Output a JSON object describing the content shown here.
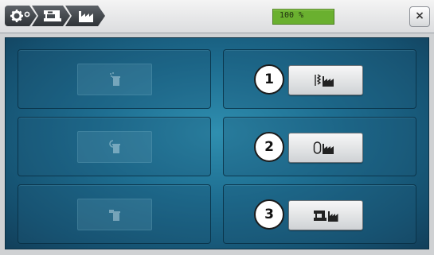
{
  "toolbar": {
    "breadcrumbs": [
      {
        "icon": "settings-icon"
      },
      {
        "icon": "machine-icon"
      },
      {
        "icon": "factory-icon"
      }
    ],
    "progress": {
      "value_text": "100 %",
      "value": 1.0,
      "color": "#6ab02f"
    },
    "close_label": "×"
  },
  "options": [
    {
      "number": "1",
      "icon": "stitch-factory-reset-icon"
    },
    {
      "number": "2",
      "icon": "hoop-factory-reset-icon"
    },
    {
      "number": "3",
      "icon": "machine-factory-reset-icon"
    }
  ],
  "disabled_options": [
    {
      "icon": "user-data-delete-icon"
    },
    {
      "icon": "user-data-delete-icon"
    },
    {
      "icon": "user-data-delete-icon"
    }
  ],
  "colors": {
    "accent": "#1e6e91",
    "panel_border": "#0c3145"
  }
}
